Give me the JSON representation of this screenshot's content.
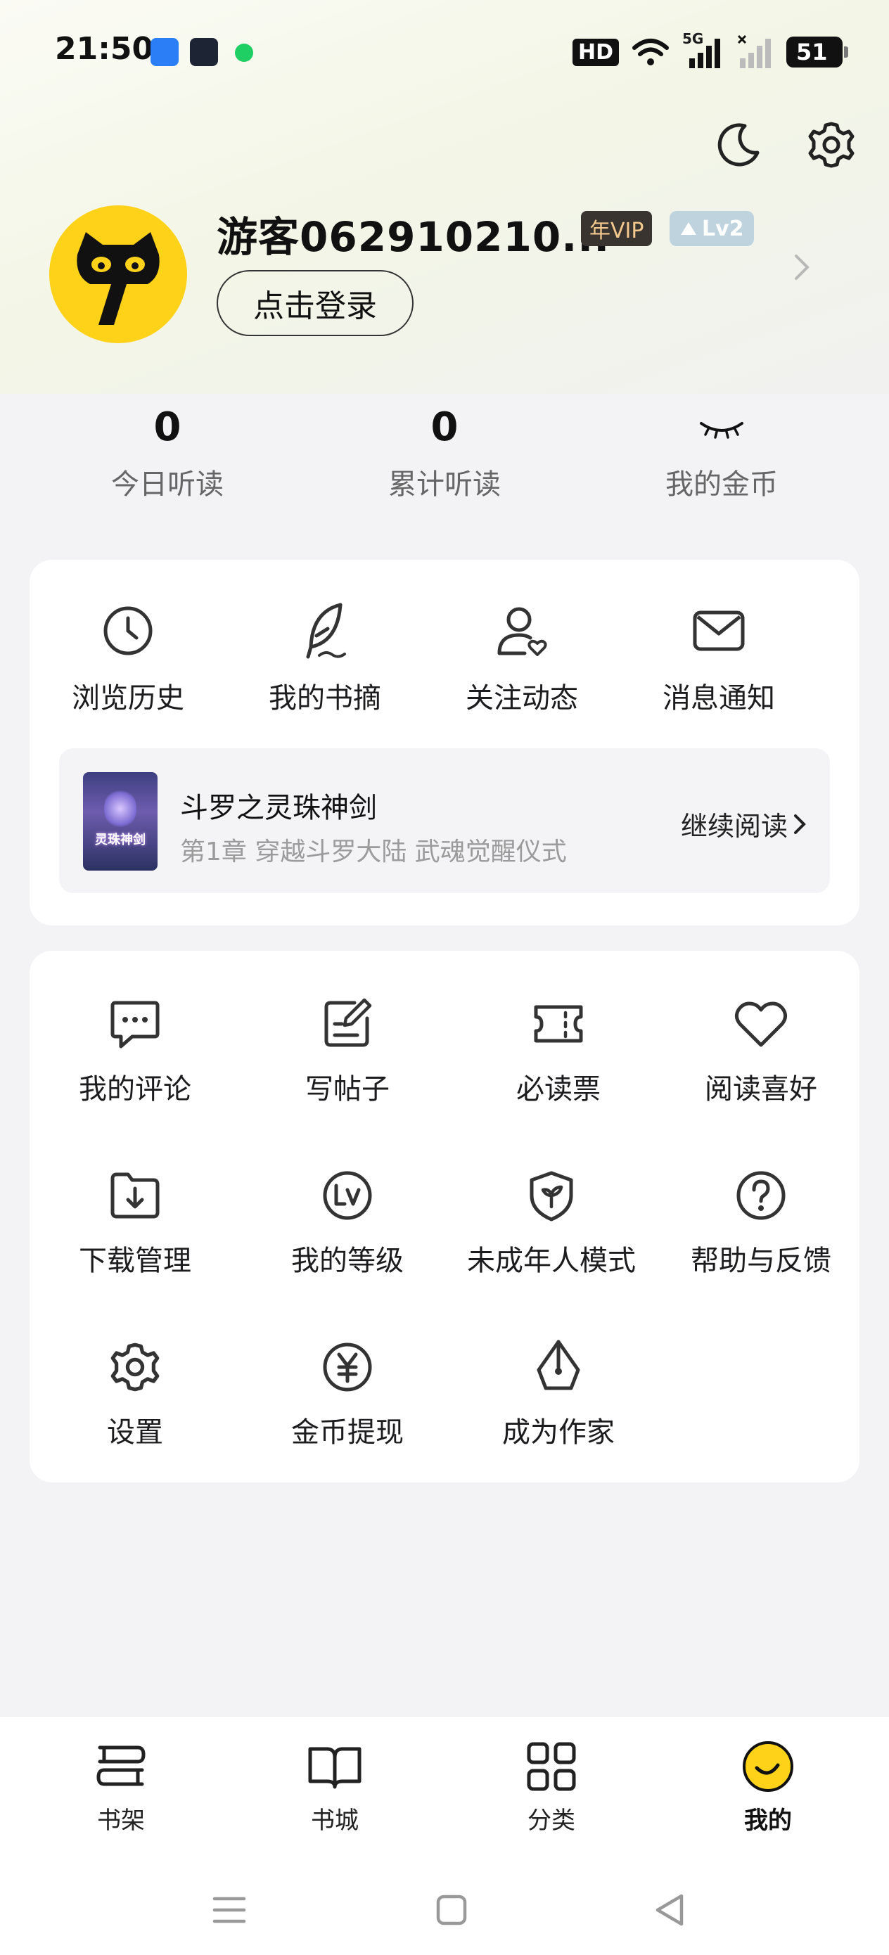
{
  "status_bar": {
    "time": "21:50",
    "hd": "HD",
    "network": "5G",
    "battery": "51"
  },
  "profile": {
    "username": "游客062910210...",
    "vip_badge": "年VIP",
    "level_badge": "Lv2",
    "login_button": "点击登录"
  },
  "stats": [
    {
      "value": "0",
      "label": "今日听读"
    },
    {
      "value": "0",
      "label": "累计听读"
    },
    {
      "value": "",
      "label": "我的金币"
    }
  ],
  "quick_actions": [
    {
      "label": "浏览历史",
      "icon": "clock-icon"
    },
    {
      "label": "我的书摘",
      "icon": "feather-icon"
    },
    {
      "label": "关注动态",
      "icon": "user-heart-icon"
    },
    {
      "label": "消息通知",
      "icon": "mail-icon"
    }
  ],
  "continue_reading": {
    "book_title": "斗罗之灵珠神剑",
    "chapter": "第1章 穿越斗罗大陆 武魂觉醒仪式",
    "cover_text": "灵珠神剑",
    "button": "继续阅读"
  },
  "menu": [
    {
      "label": "我的评论",
      "icon": "comment-icon"
    },
    {
      "label": "写帖子",
      "icon": "edit-icon"
    },
    {
      "label": "必读票",
      "icon": "ticket-icon"
    },
    {
      "label": "阅读喜好",
      "icon": "heart-icon"
    },
    {
      "label": "下载管理",
      "icon": "download-icon"
    },
    {
      "label": "我的等级",
      "icon": "level-icon"
    },
    {
      "label": "未成年人模式",
      "icon": "sprout-shield-icon"
    },
    {
      "label": "帮助与反馈",
      "icon": "help-icon"
    },
    {
      "label": "设置",
      "icon": "gear-icon"
    },
    {
      "label": "金币提现",
      "icon": "yuan-icon"
    },
    {
      "label": "成为作家",
      "icon": "pen-nib-icon"
    }
  ],
  "bottom_nav": [
    {
      "label": "书架",
      "icon": "bookshelf-icon"
    },
    {
      "label": "书城",
      "icon": "book-open-icon"
    },
    {
      "label": "分类",
      "icon": "grid-icon"
    },
    {
      "label": "我的",
      "icon": "smile-icon"
    }
  ],
  "colors": {
    "accent_yellow": "#ffd21a",
    "vip_bg": "#3a3431",
    "vip_text": "#f3c98d",
    "level_bg": "#bfd3df"
  }
}
